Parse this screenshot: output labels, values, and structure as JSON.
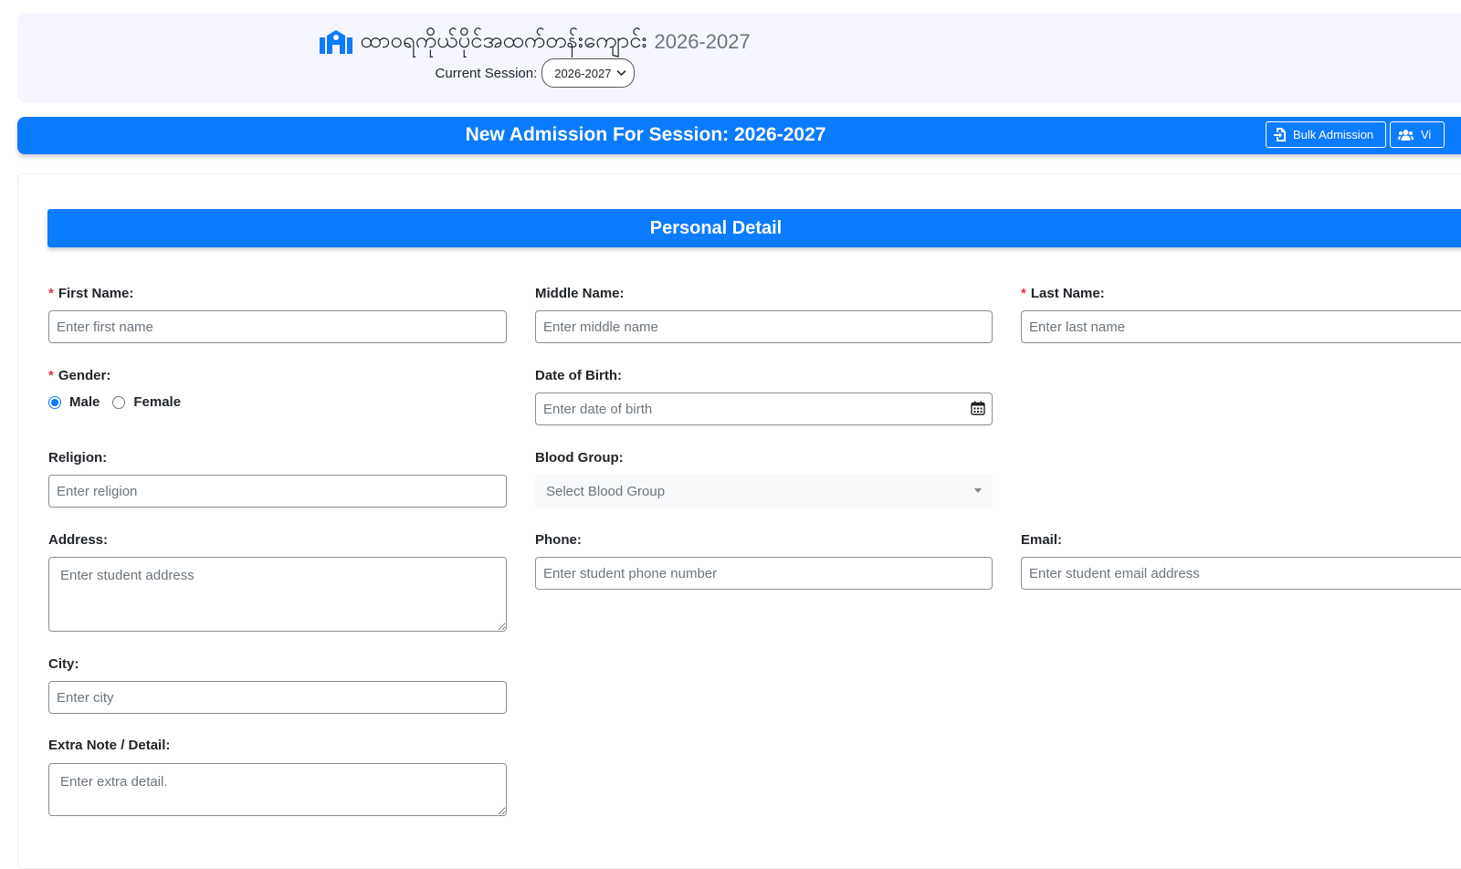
{
  "header": {
    "school_name": "ထာဝရကိုယ်ပိုင်အထက်တန်းကျောင်း",
    "year": "2026-2027",
    "current_session_label": "Current Session:",
    "current_session_value": "2026-2027",
    "logo_icon": "school-icon"
  },
  "admission_bar": {
    "title": "New Admission For Session: 2026-2027",
    "bulk_admission_label": "Bulk Admission",
    "view_label": "Vi"
  },
  "section": {
    "title": "Personal Detail"
  },
  "form": {
    "first_name": {
      "label": "First Name:",
      "placeholder": "Enter first name",
      "required": "*"
    },
    "middle_name": {
      "label": "Middle Name:",
      "placeholder": "Enter middle name"
    },
    "last_name": {
      "label": "Last Name:",
      "placeholder": "Enter last name",
      "required": "*"
    },
    "gender": {
      "label": "Gender:",
      "required": "*",
      "options": [
        "Male",
        "Female"
      ],
      "selected": "Male"
    },
    "dob": {
      "label": "Date of Birth:",
      "placeholder": "Enter date of birth"
    },
    "religion": {
      "label": "Religion:",
      "placeholder": "Enter religion"
    },
    "blood_group": {
      "label": "Blood Group:",
      "placeholder": "Select Blood Group"
    },
    "address": {
      "label": "Address:",
      "placeholder": "Enter student address"
    },
    "phone": {
      "label": "Phone:",
      "placeholder": "Enter student phone number"
    },
    "email": {
      "label": "Email:",
      "placeholder": "Enter student email address"
    },
    "city": {
      "label": "City:",
      "placeholder": "Enter city"
    },
    "extra_note": {
      "label": "Extra Note / Detail:",
      "placeholder": "Enter extra detail."
    }
  },
  "colors": {
    "primary": "#0b7bff",
    "required": "#dc3545",
    "header_bg": "#f5f6fe"
  }
}
